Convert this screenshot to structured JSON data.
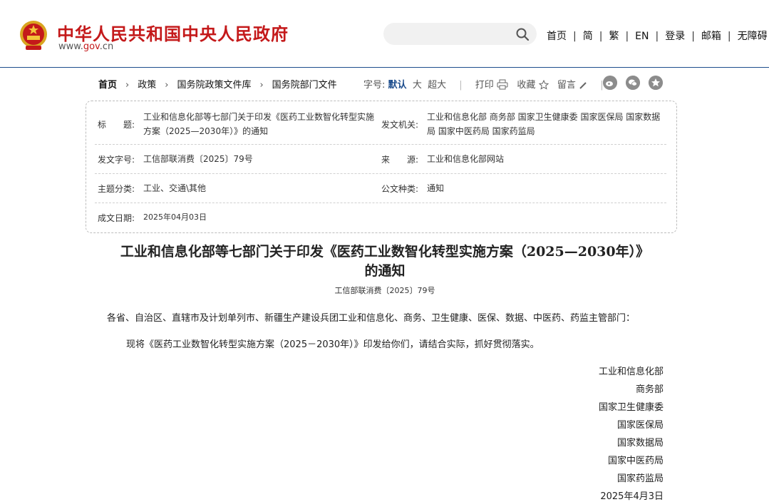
{
  "header": {
    "site_title": "中华人民共和国中央人民政府",
    "site_url_prefix": "www.",
    "site_url_highlight": "gov",
    "site_url_suffix": ".cn",
    "search_placeholder": "",
    "nav": [
      "首页",
      "简",
      "繁",
      "EN",
      "登录",
      "邮箱",
      "无障碍"
    ]
  },
  "breadcrumb": [
    "首页",
    "政策",
    "国务院政策文件库",
    "国务院部门文件"
  ],
  "toolbar": {
    "font_size_label": "字号:",
    "font_sizes": [
      "默认",
      "大",
      "超大"
    ],
    "print": "打印",
    "favorite": "收藏",
    "comment": "留言"
  },
  "meta": {
    "title_label": "标　　题:",
    "title_value": "工业和信息化部等七部门关于印发《医药工业数智化转型实施方案（2025—2030年）》的通知",
    "issuer_label": "发文机关:",
    "issuer_value": "工业和信息化部 商务部 国家卫生健康委 国家医保局 国家数据局 国家中医药局 国家药监局",
    "doc_no_label": "发文字号:",
    "doc_no_value": "工信部联消费〔2025〕79号",
    "source_label": "来　　源:",
    "source_value": "工业和信息化部网站",
    "category_label": "主题分类:",
    "category_value": "工业、交通\\其他",
    "type_label": "公文种类:",
    "type_value": "通知",
    "date_label": "成文日期:",
    "date_value": "2025年04月03日"
  },
  "article": {
    "title_line1": "工业和信息化部等七部门关于印发《医药工业数智化转型实施方案（2025—2030年）》",
    "title_line2": "的通知",
    "doc_no": "工信部联消费〔2025〕79号",
    "salutation": "各省、自治区、直辖市及计划单列市、新疆生产建设兵团工业和信息化、商务、卫生健康、医保、数据、中医药、药监主管部门：",
    "body": "现将《医药工业数智化转型实施方案（2025－2030年）》印发给你们，请结合实际，抓好贯彻落实。",
    "signatories": [
      "工业和信息化部",
      "商务部",
      "国家卫生健康委",
      "国家医保局",
      "国家数据局",
      "国家中医药局",
      "国家药监局"
    ],
    "date": "2025年4月3日"
  },
  "colors": {
    "brand_red": "#c4191a",
    "nav_blue": "#1d4d8d"
  }
}
